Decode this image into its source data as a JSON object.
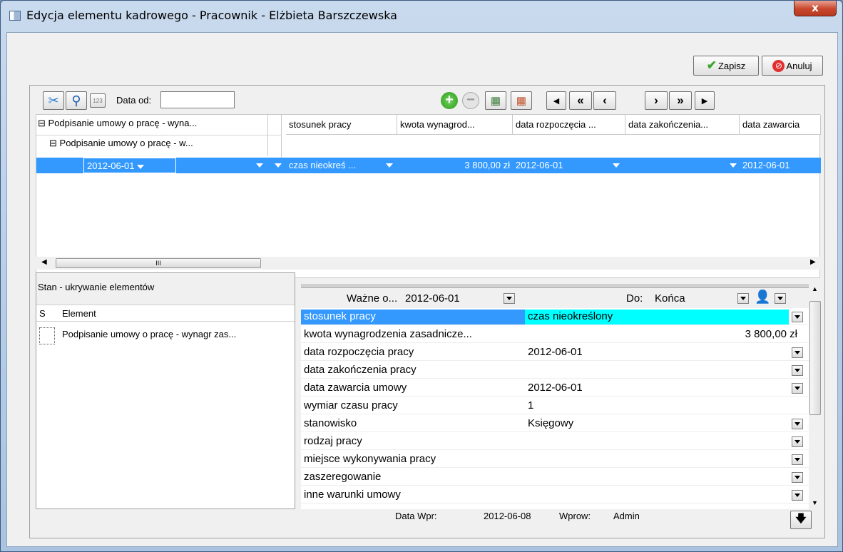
{
  "window": {
    "title": "Edycja elementu kadrowego - Pracownik - Elżbieta Barszczewska",
    "close": "x"
  },
  "actions": {
    "save_label": "Zapisz",
    "cancel_label": "Anuluj"
  },
  "toolbar": {
    "date_from_label": "Data od:",
    "date_from_value": "",
    "calc_label": "123"
  },
  "grid": {
    "tree": [
      {
        "label": "Podpisanie umowy o pracę - wyna...",
        "expander": "⊟"
      },
      {
        "label": "Podpisanie umowy o pracę - w...",
        "expander": "⊟"
      }
    ],
    "columns": [
      "stosunek pracy",
      "kwota wynagrod...",
      "data rozpoczęcia ...",
      "data zakończenia...",
      "data zawarcia"
    ],
    "selected_row": {
      "date": "2012-06-01",
      "stosunek": "czas nieokreś ...",
      "kwota": "3 800,00 zł",
      "data_rozp": "2012-06-01",
      "data_zak": "",
      "data_zaw": "2012-06-01"
    },
    "scroll_grip": "III"
  },
  "left_panel": {
    "title": "Stan - ukrywanie elementów",
    "col_s": "S",
    "col_element": "Element",
    "rows": [
      {
        "label": "Podpisanie umowy o pracę - wynagr zas..."
      }
    ]
  },
  "properties": {
    "valid_from_label": "Ważne o...",
    "valid_from_value": "2012-06-01",
    "valid_to_label": "Do:",
    "valid_to_value": "Końca",
    "rows": [
      {
        "name": "stosunek pracy",
        "value": "czas nieokreślony",
        "dropdown": true
      },
      {
        "name": "kwota wynagrodzenia zasadnicze...",
        "value": "3 800,00 zł",
        "dropdown": false
      },
      {
        "name": "data rozpoczęcia pracy",
        "value": "2012-06-01",
        "dropdown": true
      },
      {
        "name": "data zakończenia pracy",
        "value": "",
        "dropdown": true
      },
      {
        "name": "data zawarcia umowy",
        "value": "2012-06-01",
        "dropdown": true
      },
      {
        "name": "wymiar czasu pracy",
        "value": "1",
        "dropdown": false
      },
      {
        "name": "stanowisko",
        "value": "Księgowy",
        "dropdown": true
      },
      {
        "name": "rodzaj pracy",
        "value": "",
        "dropdown": true
      },
      {
        "name": "miejsce wykonywania pracy",
        "value": "",
        "dropdown": true
      },
      {
        "name": "zaszeregowanie",
        "value": "",
        "dropdown": true
      },
      {
        "name": "inne warunki umowy",
        "value": "",
        "dropdown": true
      }
    ]
  },
  "footer": {
    "data_wpr_label": "Data Wpr:",
    "data_wpr_value": "2012-06-08",
    "wprow_label": "Wprow:",
    "wprow_value": "Admin"
  },
  "colors": {
    "selection": "#3399ff",
    "highlight_cell": "#00ffff"
  }
}
